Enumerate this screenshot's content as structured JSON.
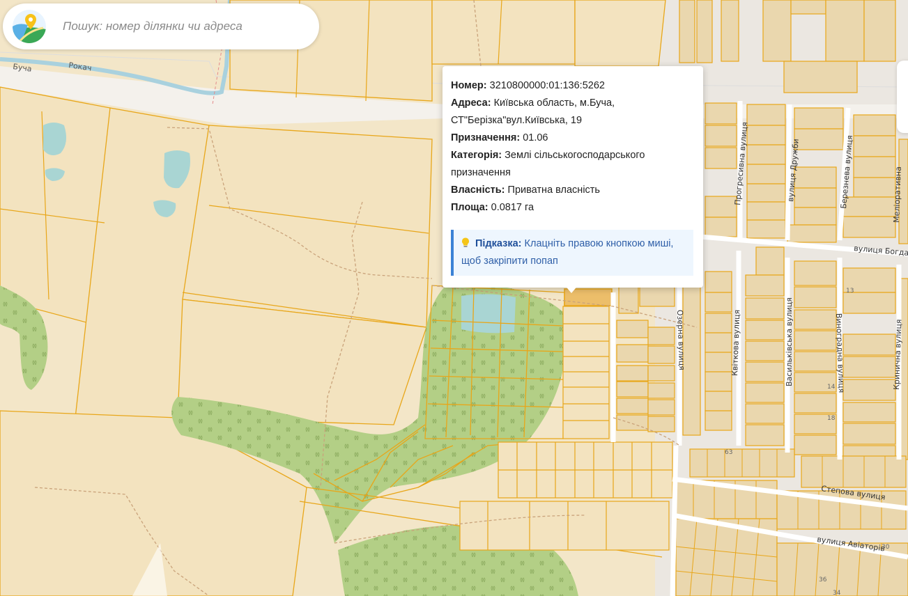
{
  "search": {
    "placeholder": "Пошук: номер ділянки чи адреса"
  },
  "popup": {
    "number_label": "Номер:",
    "number_value": "3210800000:01:136:5262",
    "address_label": "Адреса:",
    "address_value": "Київська область, м.Буча, СТ\"Берізка\"вул.Київська, 19",
    "purpose_label": "Призначення:",
    "purpose_value": "01.06",
    "category_label": "Категорія:",
    "category_value": "Землі сільськогосподарського призначення",
    "ownership_label": "Власність:",
    "ownership_value": "Приватна власність",
    "area_label": "Площа:",
    "area_value": "0.0817 га",
    "hint_label": "Підказка:",
    "hint_text": "Клацніть правою кнопкою миші, щоб закріпити попап"
  },
  "map_labels": {
    "bucha": "Буча",
    "river": "Рокач",
    "prohresyvna": "Прогресивна вулиця",
    "druzhby": "вулиця Дружби",
    "berezneva": "Березнева вулиця",
    "melioratyvna": "Меліоративна",
    "bohdana": "вулиця Богдана",
    "ozerna": "Озерна вулиця",
    "kvitkova": "Квіткова вулиця",
    "vasylkivska": "Васильківська вулиця",
    "vynohradna": "Виноградна вулиця",
    "krynychna": "Кринична вулиця",
    "stepova": "Степова вулиця",
    "aviatoriv": "вулиця Авіаторів",
    "h63": "63",
    "h13": "13",
    "h14": "14",
    "h18": "18",
    "h30": "30",
    "h36": "36",
    "h34": "34"
  },
  "colors": {
    "background": "#f2eadb",
    "parcel_fill": "#f3e3bf",
    "parcel_border": "#e8a619",
    "building_fill": "#e7d3a8",
    "forest": "#b3cf86",
    "water": "#aad3df",
    "road": "#ffffff",
    "hint_border": "#3b82d6",
    "hint_bg": "#eef6fe",
    "selected_parcel": "#ecbe6a"
  },
  "icons": {
    "logo": "map-pin-logo-icon",
    "hint": "lightbulb-icon",
    "forest": "tree-icon"
  }
}
